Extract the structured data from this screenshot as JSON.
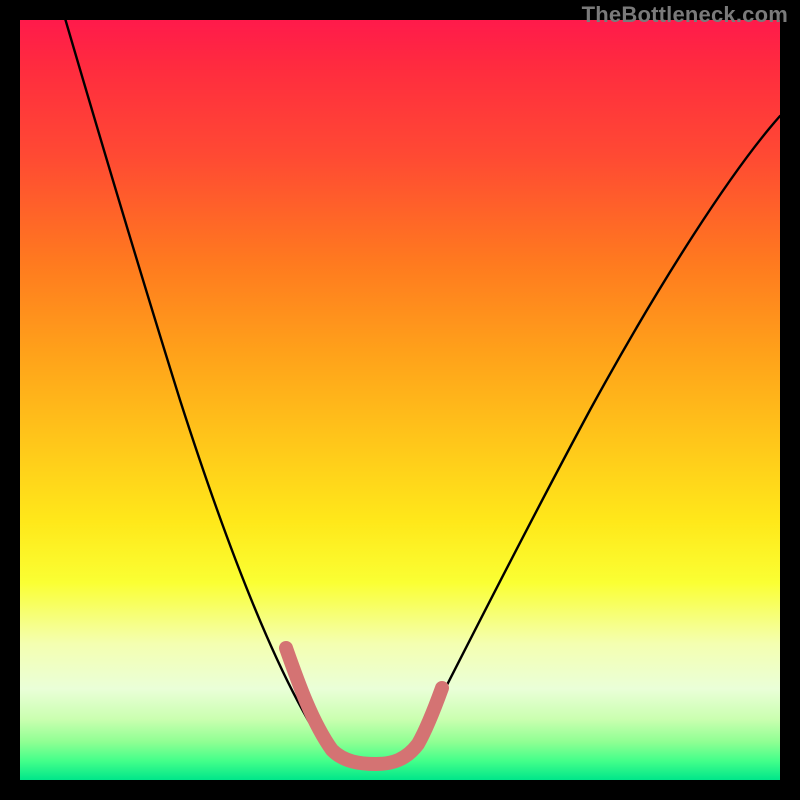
{
  "watermark": "TheBottleneck.com",
  "colors": {
    "background": "#000000",
    "gradient_top": "#ff1a4b",
    "gradient_bottom": "#00e68a",
    "curve": "#000000",
    "highlight": "#d47373"
  },
  "chart_data": {
    "type": "line",
    "title": "",
    "xlabel": "",
    "ylabel": "",
    "xlim": [
      0,
      100
    ],
    "ylim": [
      0,
      100
    ],
    "grid": false,
    "legend": false,
    "annotations": [],
    "note": "Axes are unlabeled; x and y are normalized 0–100. y=100 corresponds to the top (red) and y=0 to the bottom (green). Values are estimated from the rendered curve shape.",
    "series": [
      {
        "name": "bottleneck-curve",
        "x": [
          0,
          4,
          8,
          12,
          16,
          20,
          24,
          28,
          32,
          36,
          38,
          40,
          42,
          44,
          46,
          48,
          50,
          52,
          54,
          58,
          64,
          72,
          80,
          88,
          96,
          100
        ],
        "y": [
          108,
          100,
          90,
          79,
          68,
          56,
          45,
          35,
          26,
          17,
          13,
          9,
          5.5,
          3.5,
          2.6,
          2.4,
          2.4,
          2.8,
          4.2,
          10,
          20,
          34,
          48,
          60,
          71,
          76
        ]
      },
      {
        "name": "highlight-segment",
        "x": [
          35.5,
          37,
          38.5,
          40,
          41.5,
          43,
          44.5,
          46,
          47.5,
          49,
          50.5,
          52,
          53.5,
          55
        ],
        "y": [
          18,
          14,
          11,
          8.5,
          6,
          4.4,
          3.3,
          2.7,
          2.5,
          2.5,
          2.8,
          3.6,
          5.2,
          8.5
        ]
      }
    ]
  }
}
